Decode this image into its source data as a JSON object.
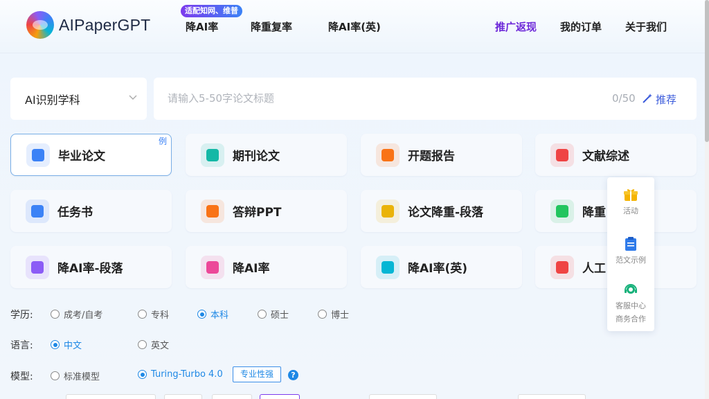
{
  "header": {
    "logo_text": "AIPaperGPT",
    "badge": "适配知网、维普",
    "nav_left": [
      "降AI率",
      "降重复率",
      "降AI率(英)"
    ],
    "nav_right": [
      "推广返现",
      "我的订单",
      "关于我们"
    ]
  },
  "search": {
    "subject_select": "AI识别学科",
    "title_placeholder": "请输入5-50字论文标题",
    "counter": "0/50",
    "recommend": "推荐"
  },
  "cards": [
    {
      "label": "毕业论文",
      "icon": "graduation-cap-icon",
      "color": "#3b82f6",
      "example": "例"
    },
    {
      "label": "期刊论文",
      "icon": "journal-icon",
      "color": "#14b8a6"
    },
    {
      "label": "开题报告",
      "icon": "report-icon",
      "color": "#f97316"
    },
    {
      "label": "文献综述",
      "icon": "review-icon",
      "color": "#ef4444"
    },
    {
      "label": "任务书",
      "icon": "task-book-icon",
      "color": "#3b82f6"
    },
    {
      "label": "答辩PPT",
      "icon": "ppt-icon",
      "color": "#f97316"
    },
    {
      "label": "论文降重-段落",
      "icon": "rewrite-icon",
      "color": "#eab308"
    },
    {
      "label": "降重",
      "icon": "dedupe-icon",
      "color": "#22c55e"
    },
    {
      "label": "降AI率-段落",
      "icon": "ai-reduce-paragraph-icon",
      "color": "#8b5cf6"
    },
    {
      "label": "降AI率",
      "icon": "ai-reduce-icon",
      "color": "#ec4899"
    },
    {
      "label": "降AI率(英)",
      "icon": "ai-reduce-en-icon",
      "color": "#06b6d4"
    },
    {
      "label": "人工",
      "icon": "human-service-icon",
      "color": "#ef4444"
    }
  ],
  "float_panel": {
    "activity": "活动",
    "samples": "范文示例",
    "service_line1": "客服中心",
    "service_line2": "商务合作"
  },
  "options": {
    "education_label": "学历:",
    "education": [
      "成考/自考",
      "专科",
      "本科",
      "硕士",
      "博士"
    ],
    "education_selected": "本科",
    "language_label": "语言:",
    "language": [
      "中文",
      "英文"
    ],
    "language_selected": "中文",
    "model_label": "模型:",
    "model": [
      "标准模型",
      "Turing-Turbo 4.0"
    ],
    "model_selected": "Turing-Turbo 4.0",
    "model_tag": "专业性强"
  },
  "colors": {
    "accent": "#1e88e5",
    "promo": "#6d28d9",
    "active_border": "#79aee6"
  }
}
